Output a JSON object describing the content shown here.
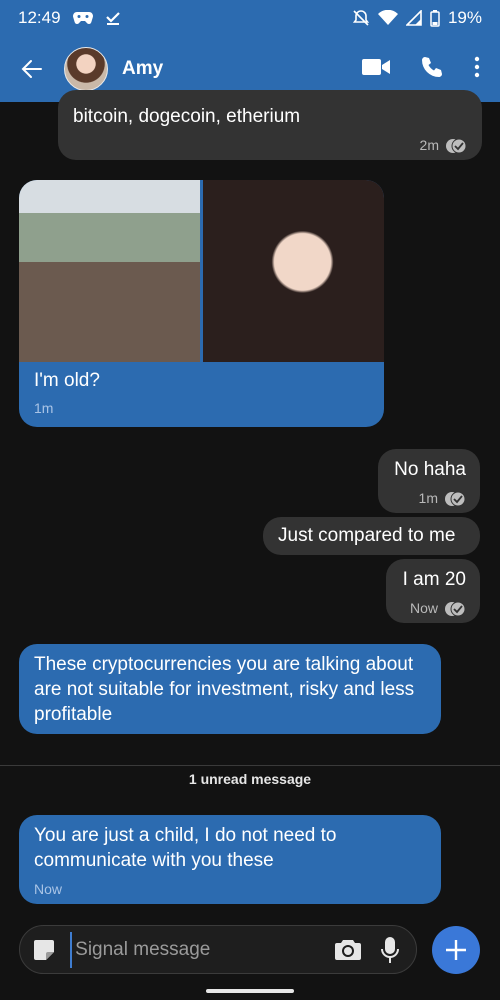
{
  "status_bar": {
    "time": "12:49",
    "battery": "19%"
  },
  "header": {
    "contact_name": "Amy"
  },
  "messages": [
    {
      "direction": "incoming",
      "text": "bitcoin, dogecoin, etherium",
      "time": "2m"
    },
    {
      "direction": "incoming",
      "type": "photos",
      "caption": "I'm old?",
      "time": "1m"
    },
    {
      "direction": "outgoing",
      "text": "No haha",
      "time": "1m"
    },
    {
      "direction": "outgoing",
      "text": "Just compared to me"
    },
    {
      "direction": "outgoing",
      "text": "I am 20",
      "time": "Now"
    },
    {
      "direction": "incoming",
      "text": "These cryptocurrencies you are talking about are not suitable for investment, risky and less profitable"
    },
    {
      "direction": "incoming",
      "text": "You are just a child, I do not need to communicate with you these",
      "time": "Now"
    }
  ],
  "unread_divider": "1 unread message",
  "composer": {
    "placeholder": "Signal message"
  },
  "icons": {
    "back": "arrow-left-icon",
    "video": "video-camera-icon",
    "call": "phone-icon",
    "more": "more-vert-icon",
    "sticker": "sticker-icon",
    "camera": "camera-icon",
    "mic": "microphone-icon",
    "attach": "plus-icon",
    "delivered": "double-check-icon"
  },
  "colors": {
    "accent": "#2c6bb0",
    "background": "#121212",
    "outgoing_bubble": "#333333",
    "fab": "#3a78d8"
  }
}
